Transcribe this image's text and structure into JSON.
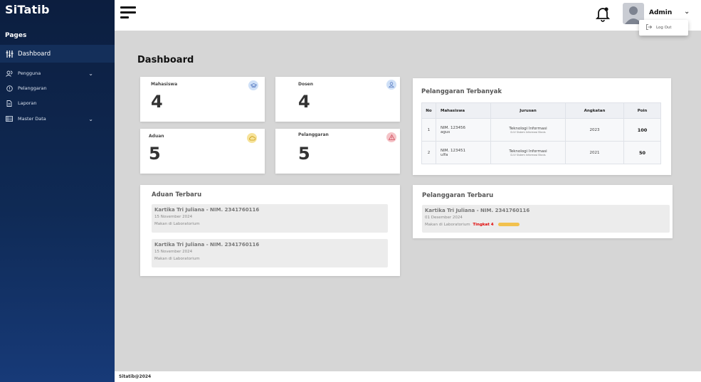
{
  "sidebar": {
    "brand": "SiTatib",
    "section_title": "Pages",
    "items": [
      {
        "label": "Dashboard",
        "icon": "sliders-icon"
      },
      {
        "label": "Pengguna",
        "icon": "users-icon"
      },
      {
        "label": "Pelanggaran",
        "icon": "alert-circle-icon"
      },
      {
        "label": "Laporan",
        "icon": "document-icon"
      },
      {
        "label": "Master Data",
        "icon": "list-icon"
      }
    ]
  },
  "topbar": {
    "user_name": "Admin",
    "logout_label": "Log Out"
  },
  "main": {
    "title": "Dashboard",
    "stats": [
      {
        "label": "Mahasiswa",
        "value": "4",
        "icon": "graduation-cap-icon",
        "color": "#cfe0f7"
      },
      {
        "label": "Dosen",
        "value": "4",
        "icon": "user-icon",
        "color": "#cfe0f7"
      },
      {
        "label": "Aduan",
        "value": "5",
        "icon": "cloud-icon",
        "color": "#f7e39a"
      },
      {
        "label": "Pelanggaran",
        "value": "5",
        "icon": "warning-icon",
        "color": "#f5c4c8"
      }
    ],
    "top_violations": {
      "title": "Pelanggaran Terbanyak",
      "columns": [
        "No",
        "Mahasiswa",
        "Jurusan",
        "Angkatan",
        "Poin"
      ],
      "rows": [
        {
          "no": "1",
          "nim": "NIM. 123456",
          "name": "agus",
          "jurusan": "Teknologi Informasi",
          "prodi": "D-IV Sistem Informasi Bisnis",
          "angkatan": "2023",
          "poin": "100"
        },
        {
          "no": "2",
          "nim": "NIM. 123451",
          "name": "ulfa",
          "jurusan": "Teknologi Informasi",
          "prodi": "D-IV Sistem Informasi Bisnis",
          "angkatan": "2021",
          "poin": "50"
        }
      ]
    },
    "latest_complaints": {
      "title": "Aduan Terbaru",
      "items": [
        {
          "title": "Kartika Tri Juliana - NIM. 2341760116",
          "date": "15 November 2024",
          "desc": "Makan di Laboratorium"
        },
        {
          "title": "Kartika Tri Juliana - NIM. 2341760116",
          "date": "15 November 2024",
          "desc": "Makan di Laboratorium"
        }
      ]
    },
    "latest_violations": {
      "title": "Pelanggaran Terbaru",
      "items": [
        {
          "title": "Kartika Tri Juliana - NIM. 2341760116",
          "date": "01 Desember 2024",
          "desc": "Makan di Laboratorium",
          "level": "Tingkat 4",
          "level_color": "#e00000"
        }
      ]
    }
  },
  "footer": {
    "text": "Sitatib@2024"
  }
}
